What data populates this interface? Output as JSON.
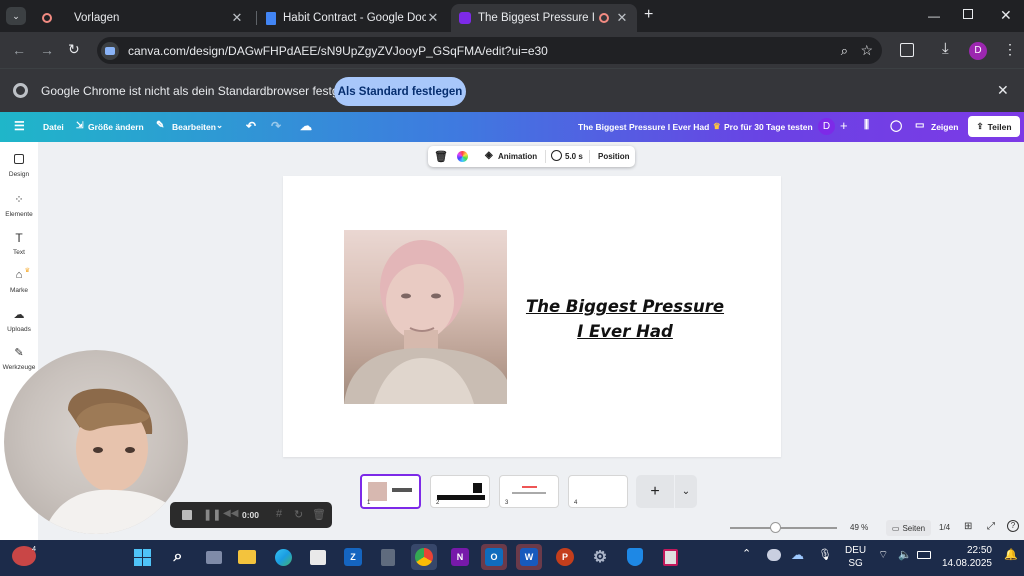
{
  "browser": {
    "tabs": [
      {
        "title": "Vorlagen",
        "active": false
      },
      {
        "title": "Habit Contract - Google Docs",
        "active": false
      },
      {
        "title": "The Biggest Pressure I Ever",
        "active": true
      }
    ],
    "new_tab": "+",
    "url": "canva.com/design/DAGwFHPdAEE/sN9UpZgyZVJooyP_GSqFMA/edit?ui=e30",
    "profile_initial": "D"
  },
  "infobar": {
    "message": "Google Chrome ist nicht als dein Standardbrowser festgelegt",
    "button": "Als Standard festlegen"
  },
  "canva_header": {
    "menu": "Datei",
    "resize": "Größe ändern",
    "edit": "Bearbeiten",
    "doc_title": "The Biggest Pressure I Ever Had",
    "pro": "Pro für 30 Tage testen",
    "avatar": "D",
    "present": "Zeigen",
    "share": "Teilen"
  },
  "rail": [
    {
      "label": "Design",
      "icon": "design-icon"
    },
    {
      "label": "Elemente",
      "icon": "elements-icon"
    },
    {
      "label": "Text",
      "icon": "text-icon"
    },
    {
      "label": "Marke",
      "icon": "brand-icon"
    },
    {
      "label": "Uploads",
      "icon": "upload-icon"
    },
    {
      "label": "Werkzeuge",
      "icon": "tools-icon"
    }
  ],
  "context_toolbar": {
    "animation": "Animation",
    "duration": "5.0 s",
    "position": "Position"
  },
  "slide": {
    "title_line1": "The Biggest Pressure",
    "title_line2": "I Ever Had"
  },
  "pages": [
    {
      "number": "1",
      "selected": true
    },
    {
      "number": "2",
      "selected": false
    },
    {
      "number": "3",
      "selected": false
    },
    {
      "number": "4",
      "selected": false
    }
  ],
  "recorder": {
    "time": "0:00"
  },
  "status_bar": {
    "zoom": "49 %",
    "zoom_level": 0.49,
    "pages_label": "Seiten",
    "page_count": "1/4"
  },
  "taskbar": {
    "lang_line1": "DEU",
    "lang_line2": "SG",
    "time": "22:50",
    "date": "14.08.2025"
  }
}
